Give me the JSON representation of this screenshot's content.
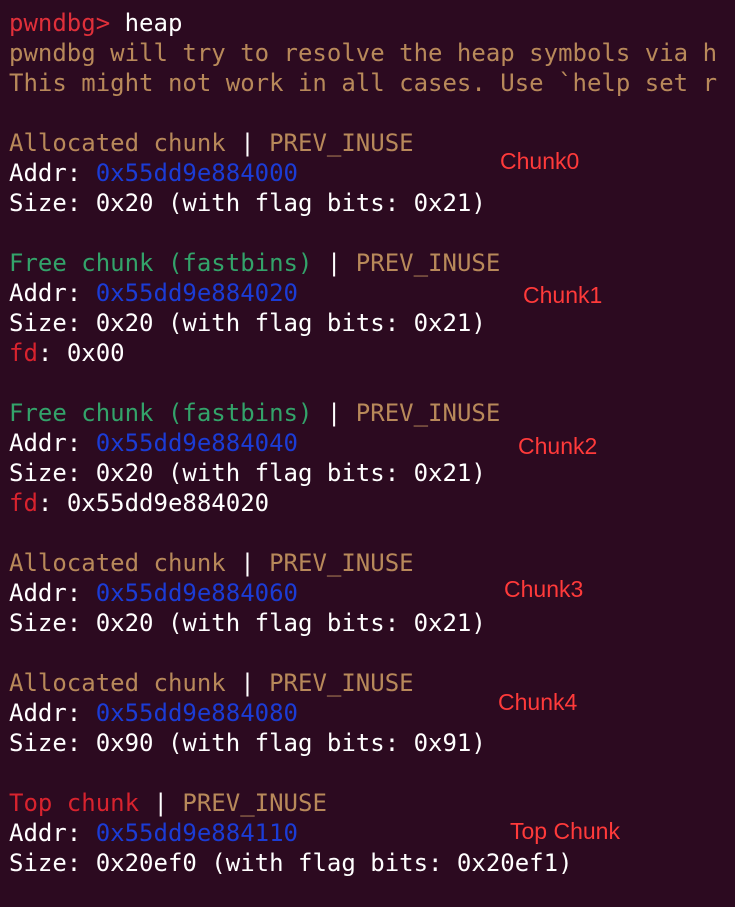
{
  "prompt": {
    "label": "pwndbg> ",
    "command": "heap"
  },
  "warning": {
    "line1": "pwndbg will try to resolve the heap symbols via h",
    "line2": "This might not work in all cases. Use `help set r"
  },
  "separator": " | ",
  "flag_text": "PREV_INUSE",
  "labels": {
    "addr": "Addr: ",
    "size": "Size: ",
    "fd": "fd",
    "fd_sep": ": "
  },
  "chunks": [
    {
      "status": "Allocated chunk",
      "addr": "0x55dd9e884000",
      "size": "0x20 (with flag bits: 0x21)",
      "annotation": "Chunk0"
    },
    {
      "status": "Free chunk (fastbins)",
      "addr": "0x55dd9e884020",
      "size": "0x20 (with flag bits: 0x21)",
      "fd": "0x00",
      "annotation": "Chunk1"
    },
    {
      "status": "Free chunk (fastbins)",
      "addr": "0x55dd9e884040",
      "size": "0x20 (with flag bits: 0x21)",
      "fd": "0x55dd9e884020",
      "annotation": "Chunk2"
    },
    {
      "status": "Allocated chunk",
      "addr": "0x55dd9e884060",
      "size": "0x20 (with flag bits: 0x21)",
      "annotation": "Chunk3"
    },
    {
      "status": "Allocated chunk",
      "addr": "0x55dd9e884080",
      "size": "0x90 (with flag bits: 0x91)",
      "annotation": "Chunk4"
    },
    {
      "status": "Top chunk",
      "addr": "0x55dd9e884110",
      "size": "0x20ef0 (with flag bits: 0x20ef1)",
      "annotation": "Top Chunk"
    }
  ],
  "colors": {
    "background": "#2c0a20",
    "prompt": "#e0303a",
    "allocated": "#b8895a",
    "free": "#33a36a",
    "top": "#d8232e",
    "address": "#1b3cd6",
    "annotation": "#ff3a3a"
  }
}
